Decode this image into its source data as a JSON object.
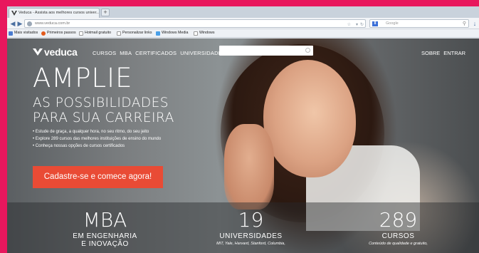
{
  "browser": {
    "tab_title": "Veduca - Assista aos melhores cursos univer...",
    "new_tab": "+",
    "url": "www.veduca.com.br",
    "search_placeholder": "Google"
  },
  "bookmarks": [
    {
      "label": "Mais visitados",
      "color": "#4a7bd0"
    },
    {
      "label": "Primeiros passos",
      "color": "#e25b1d"
    },
    {
      "label": "Hotmail gratuito",
      "color": "#dddddd"
    },
    {
      "label": "Personalizar links",
      "color": "#dddddd"
    },
    {
      "label": "Windows Media",
      "color": "#4aa0e8"
    },
    {
      "label": "Windows",
      "color": "#dddddd"
    }
  ],
  "site": {
    "logo": "veduca",
    "nav": [
      "CURSOS",
      "MBA",
      "CERTIFICADOS",
      "UNIVERSIDADES"
    ],
    "right_nav": [
      "SOBRE",
      "ENTRAR"
    ],
    "headline": "AMPLIE",
    "subline1": "AS POSSIBILIDADES",
    "subline2": "PARA SUA CARREIRA",
    "bullets": [
      "Estude de graça, a qualquer hora, no seu ritmo, do seu jeito",
      "Explore 289 cursos das melhores instituições de ensino do mundo",
      "Conheça nossas opções de cursos certificados"
    ],
    "cta": "Cadastre-se e comece agora!",
    "accent": "#e94b35"
  },
  "stats": [
    {
      "big": "MBA",
      "label1": "EM ENGENHARIA",
      "label2": "E INOVAÇÃO",
      "small": ""
    },
    {
      "big": "19",
      "label1": "UNIVERSIDADES",
      "label2": "",
      "small": "MIT, Yale, Harvard, Stanford, Columbia,"
    },
    {
      "big": "289",
      "label1": "CURSOS",
      "label2": "",
      "small": "Conteúdo de qualidade e gratuito,"
    }
  ]
}
